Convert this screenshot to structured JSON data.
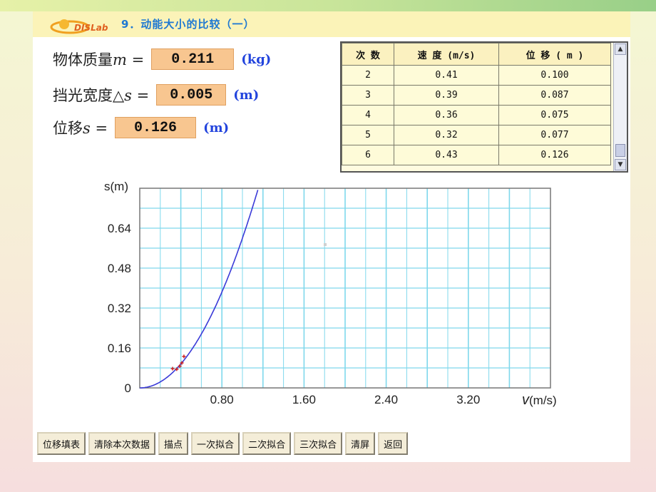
{
  "title": "9．动能大小的比较（一）",
  "logo_text": "DISLab",
  "params": [
    {
      "label": "物体质量",
      "symbol": "m",
      "suffix": " =",
      "value": "0.211",
      "unit": "(kg)"
    },
    {
      "label": "挡光宽度△",
      "symbol": "s",
      "suffix": " =",
      "value": "0.005",
      "unit": "(m)"
    },
    {
      "label": "位移",
      "symbol": "s",
      "suffix": " =",
      "value": "0.126",
      "unit": "(m)"
    }
  ],
  "table": {
    "headers": [
      "次 数",
      "速 度 (m/s)",
      "位 移 ( m )"
    ],
    "rows": [
      [
        "2",
        "0.41",
        "0.100"
      ],
      [
        "3",
        "0.39",
        "0.087"
      ],
      [
        "4",
        "0.36",
        "0.075"
      ],
      [
        "5",
        "0.32",
        "0.077"
      ],
      [
        "6",
        "0.43",
        "0.126"
      ]
    ]
  },
  "chart_data": {
    "type": "scatter",
    "ylabel": "s(m)",
    "xlabel": "v(m/s)",
    "xlim": [
      0,
      4.0
    ],
    "ylim": [
      0,
      0.8
    ],
    "x_ticks": [
      "0.80",
      "1.60",
      "2.40",
      "3.20"
    ],
    "y_ticks": [
      "0",
      "0.16",
      "0.32",
      "0.48",
      "0.64"
    ],
    "grid": true,
    "points": [
      [
        0.41,
        0.1
      ],
      [
        0.39,
        0.087
      ],
      [
        0.36,
        0.075
      ],
      [
        0.32,
        0.077
      ],
      [
        0.43,
        0.126
      ]
    ],
    "fit_curve": {
      "kind": "quadratic",
      "coef": 0.6
    },
    "colors": {
      "grid": "#7fd8ec",
      "curve": "#3a3ad8",
      "points": "#cc2222",
      "frame": "#777777"
    }
  },
  "buttons": [
    "位移填表",
    "清除本次数据",
    "描点",
    "一次拟合",
    "二次拟合",
    "三次拟合",
    "清屏",
    "返回"
  ],
  "colors": {
    "title": "#1e78d2",
    "value_box": "#f8c690",
    "unit": "#2244dd"
  }
}
